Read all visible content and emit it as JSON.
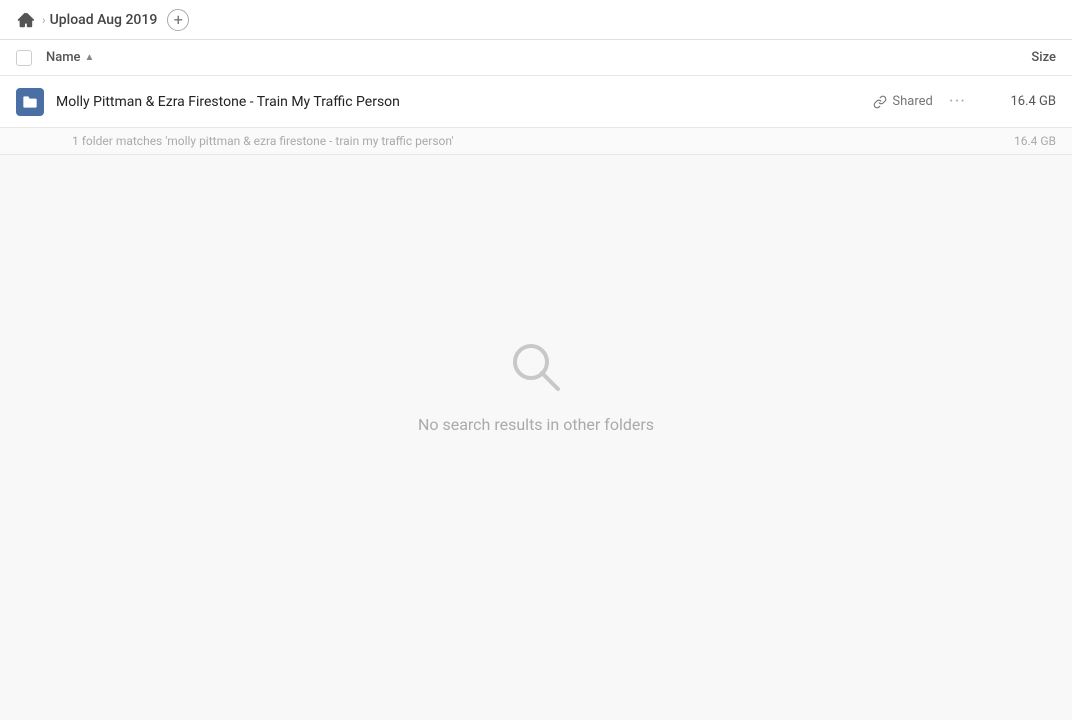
{
  "breadcrumb": {
    "home_label": "Home",
    "current": "Upload Aug 2019",
    "add_label": "+"
  },
  "columns": {
    "name_label": "Name",
    "size_label": "Size"
  },
  "file_row": {
    "name": "Molly Pittman & Ezra Firestone - Train My Traffic Person",
    "shared_label": "Shared",
    "size": "16.4 GB",
    "more_label": "···"
  },
  "match_row": {
    "text": "1 folder matches 'molly pittman & ezra firestone - train my traffic person'",
    "size": "16.4 GB"
  },
  "empty_state": {
    "text": "No search results in other folders"
  }
}
